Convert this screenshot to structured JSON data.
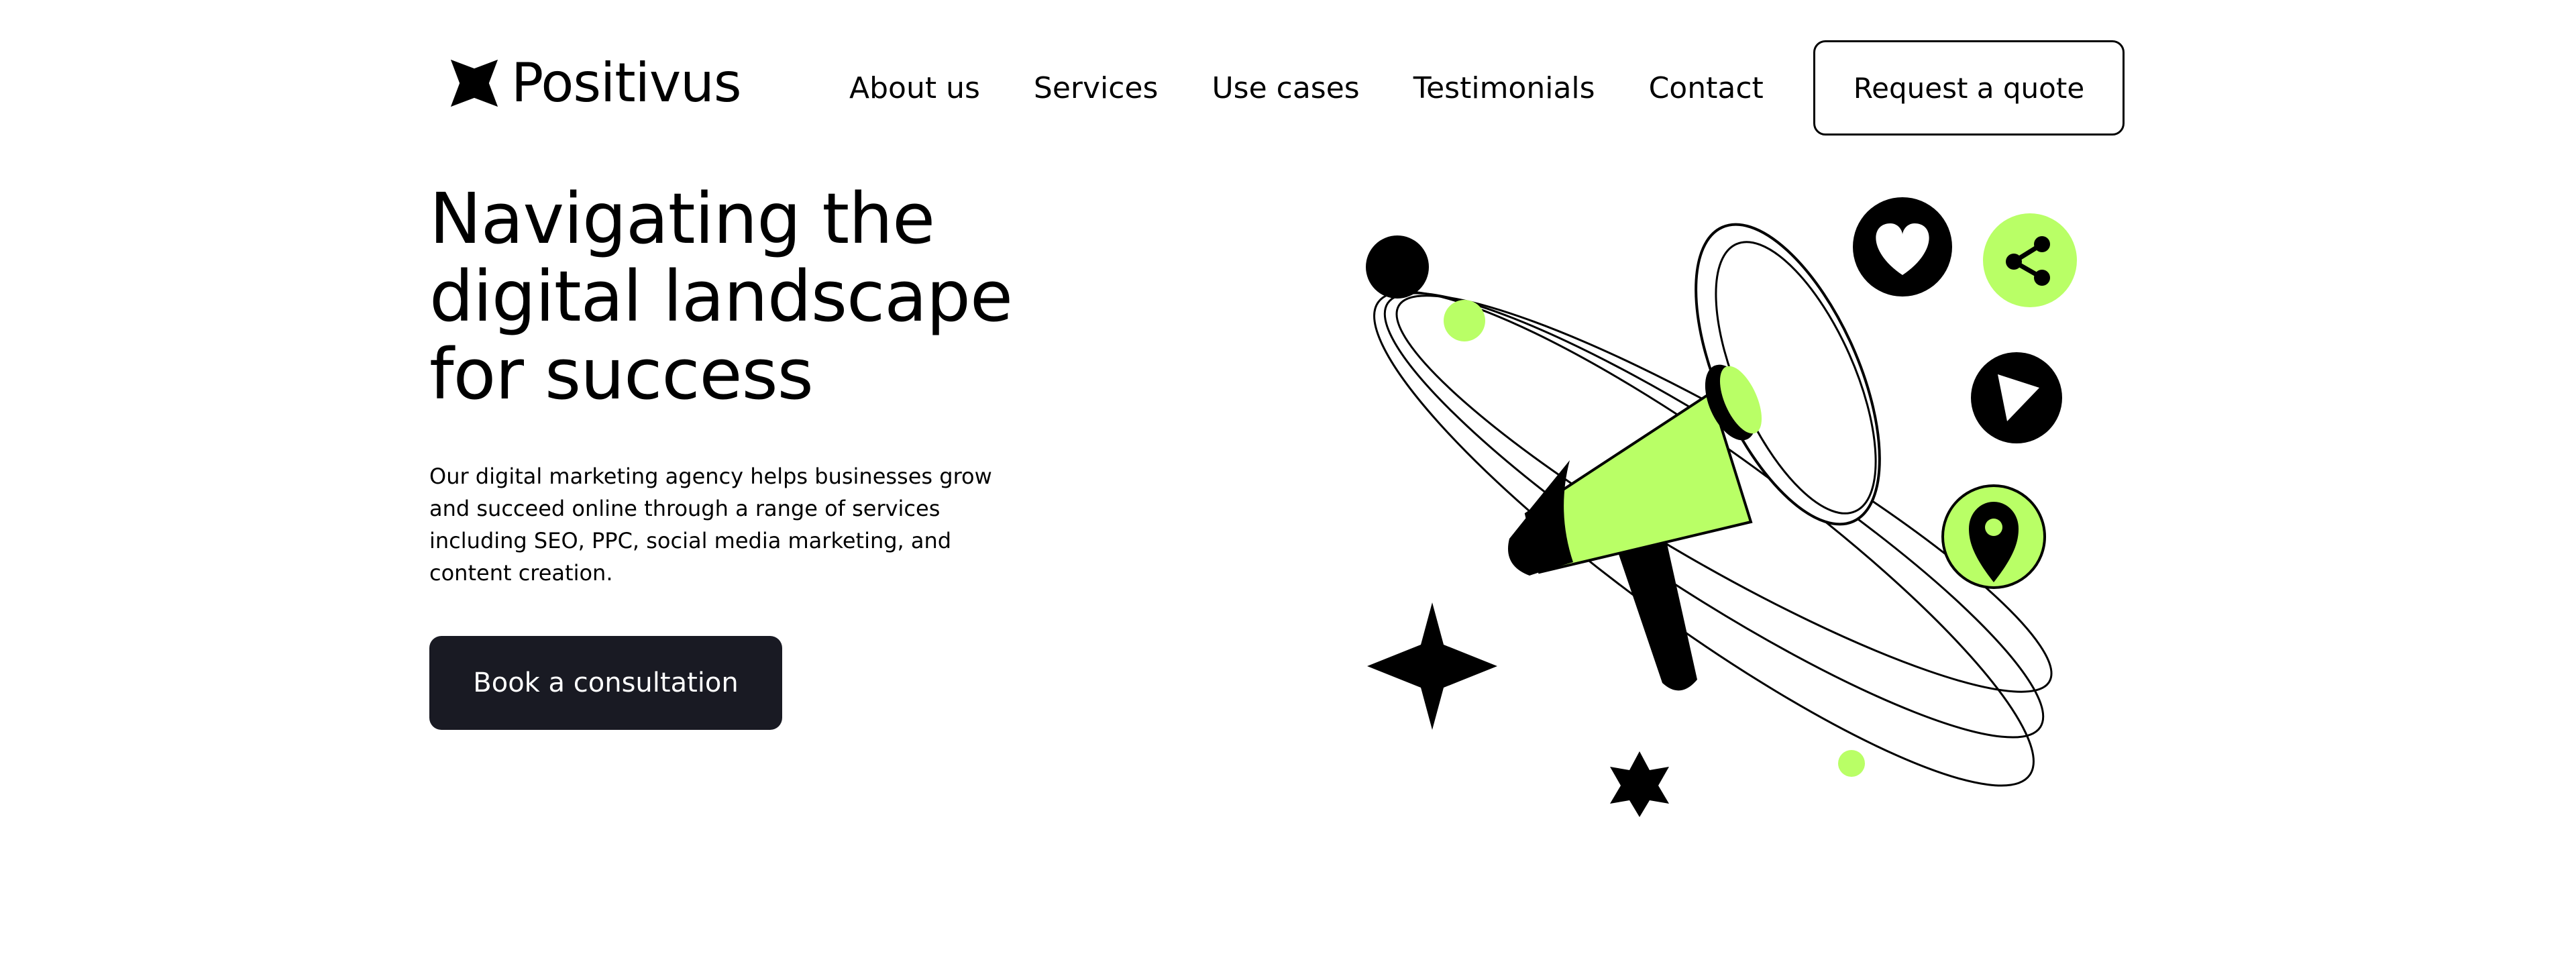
{
  "brand": {
    "name": "Positivus",
    "logo_icon": "star-logo-icon"
  },
  "nav": {
    "items": [
      {
        "label": "About us"
      },
      {
        "label": "Services"
      },
      {
        "label": "Use cases"
      },
      {
        "label": "Testimonials"
      },
      {
        "label": "Contact"
      }
    ],
    "cta_label": "Request a quote"
  },
  "hero": {
    "title_lines": [
      "Navigating the",
      "digital landscape",
      "for success"
    ],
    "description_lines": [
      "Our digital marketing agency helps businesses grow",
      "and succeed online through a range of services",
      "including SEO, PPC, social media marketing, and",
      "content creation."
    ],
    "cta_label": "Book a consultation"
  },
  "illustration": {
    "icons": [
      "megaphone-icon",
      "heart-icon",
      "share-icon",
      "play-icon",
      "location-pin-icon",
      "sparkle-star-icon"
    ]
  },
  "colors": {
    "accent": "#b9ff66",
    "dark": "#191a23",
    "text": "#000000",
    "background": "#ffffff"
  }
}
